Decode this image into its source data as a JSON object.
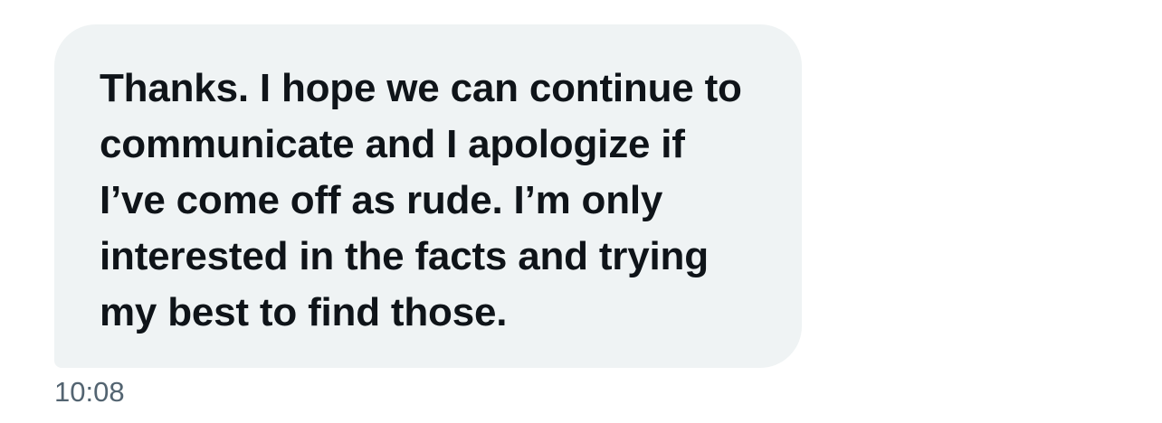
{
  "message": {
    "text": "Thanks. I hope we can continue to communicate and I apologize if I’ve come off as rude. I’m only interested in the facts and trying my best to find those.",
    "time": "10:08"
  },
  "colors": {
    "bubble_background": "#eff3f4",
    "text": "#0f1419",
    "timestamp": "#536471"
  }
}
